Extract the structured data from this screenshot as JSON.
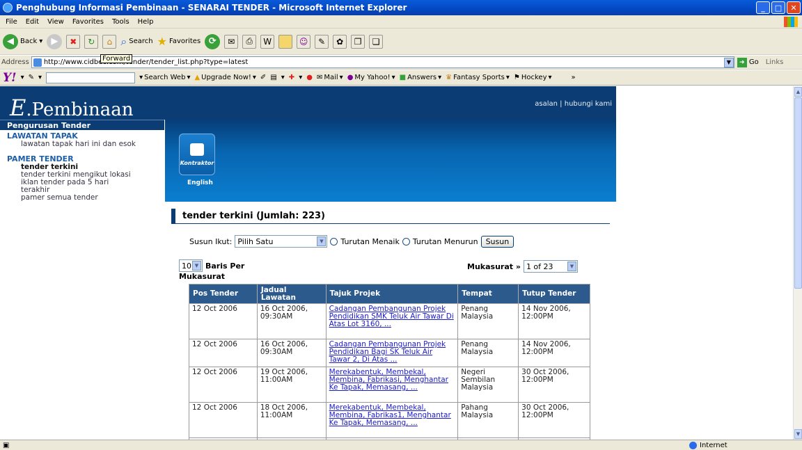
{
  "window": {
    "title": "Penghubung Informasi Pembinaan - SENARAI TENDER - Microsoft Internet Explorer"
  },
  "menu": [
    "File",
    "Edit",
    "View",
    "Favorites",
    "Tools",
    "Help"
  ],
  "toolbar": {
    "back": "Back",
    "search": "Search",
    "favorites": "Favorites",
    "tooltip": "Forward"
  },
  "address": {
    "label": "Address",
    "url": "http://www.cidbec.com/tender/tender_list.php?type=latest",
    "go": "Go",
    "links": "Links"
  },
  "yahoo": {
    "search_web": "Search Web",
    "upgrade": "Upgrade Now!",
    "mail": "Mail",
    "my_yahoo": "My Yahoo!",
    "answers": "Answers",
    "fantasy": "Fantasy Sports",
    "hockey": "Hockey"
  },
  "site": {
    "logo_e": "E",
    "logo_rest": ".Pembinaan",
    "toplinks": "asalan | hubungi kami"
  },
  "sidebar": {
    "heading": "Pengurusan Tender",
    "sections": [
      {
        "title": "LAWATAN TAPAK",
        "items": [
          "lawatan tapak hari ini dan esok"
        ]
      },
      {
        "title": "PAMER TENDER",
        "items": [
          "tender terkini",
          "tender terkini mengikut lokasi",
          "iklan tender pada 5 hari terakhir",
          "pamer semua tender"
        ]
      }
    ]
  },
  "banner": {
    "button": "Kontraktor",
    "lang": "English"
  },
  "main": {
    "title": "tender terkini (Jumlah: 223)",
    "sort_label": "Susun Ikut:",
    "sort_value": "Pilih Satu",
    "asc": "Turutan Menaik",
    "desc": "Turutan Menurun",
    "sort_button": "Susun",
    "per_page": "10",
    "per_page_label": "Baris Per",
    "per_page_label2": "Mukasurat",
    "page_label": "Mukasurat »",
    "page_value": "1 of 23"
  },
  "table": {
    "headers": [
      "Pos Tender",
      "Jadual Lawatan",
      "Tajuk Projek",
      "Tempat",
      "Tutup Tender"
    ],
    "rows": [
      [
        "12 Oct 2006",
        "16 Oct 2006, 09:30AM",
        "Cadangan Pembangunan Projek Pendidikan SMK Teluk Air Tawar Di Atas Lot 3160, ...",
        "Penang Malaysia",
        "14 Nov 2006, 12:00PM"
      ],
      [
        "12 Oct 2006",
        "16 Oct 2006, 09:30AM",
        "Cadangan Pembangunan Projek Pendidikan Bagi SK Teluk Air Tawar 2, Di Atas ...",
        "Penang Malaysia",
        "14 Nov 2006, 12:00PM"
      ],
      [
        "12 Oct 2006",
        "19 Oct 2006, 11:00AM",
        "Merekabentuk, Membekal, Membina, Fabrikasi, Menghantar Ke Tapak, Memasang, ...",
        "Negeri Sembilan Malaysia",
        "30 Oct 2006, 12:00PM"
      ],
      [
        "12 Oct 2006",
        "18 Oct 2006, 11:00AM",
        "Merekabentuk, Membekal, Membina, Fabrikas1, Menghantar Ke Tapak, Memasang, ...",
        "Pahang Malaysia",
        "30 Oct 2006, 12:00PM"
      ]
    ]
  },
  "status": {
    "zone": "Internet"
  }
}
